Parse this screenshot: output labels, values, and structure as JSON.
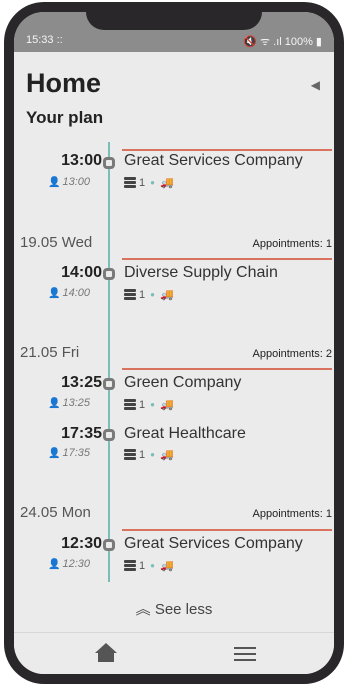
{
  "status_bar": {
    "time": "15:33 ::",
    "right": "🔇 ᯤ .ıl 100% ▮"
  },
  "header": {
    "title": "Home",
    "subtitle": "Your plan",
    "nav_icon": "navigation-arrow-icon"
  },
  "colors": {
    "timeline": "#7bbdb8",
    "separator": "#d9735f",
    "status_bar": "#8c8c8c",
    "background": "#ecebeb"
  },
  "days": [
    {
      "date": "",
      "appointments_label": "",
      "items": [
        {
          "time": "13:00",
          "subtime": "13:00",
          "company": "Great Services Company",
          "count": "1"
        }
      ]
    },
    {
      "date": "19.05 Wed",
      "appointments_label": "Appointments: 1",
      "items": [
        {
          "time": "14:00",
          "subtime": "14:00",
          "company": "Diverse Supply Chain",
          "count": "1"
        }
      ]
    },
    {
      "date": "21.05 Fri",
      "appointments_label": "Appointments: 2",
      "items": [
        {
          "time": "13:25",
          "subtime": "13:25",
          "company": "Green Company",
          "count": "1"
        },
        {
          "time": "17:35",
          "subtime": "17:35",
          "company": "Great Healthcare",
          "count": "1"
        }
      ]
    },
    {
      "date": "24.05 Mon",
      "appointments_label": "Appointments: 1",
      "items": [
        {
          "time": "12:30",
          "subtime": "12:30",
          "company": "Great Services Company",
          "count": "1"
        }
      ]
    }
  ],
  "see_less": "See less",
  "see_less_icon": "double-chevron-up-icon",
  "bottom_nav": {
    "home_icon": "home-icon",
    "menu_icon": "menu-icon"
  }
}
